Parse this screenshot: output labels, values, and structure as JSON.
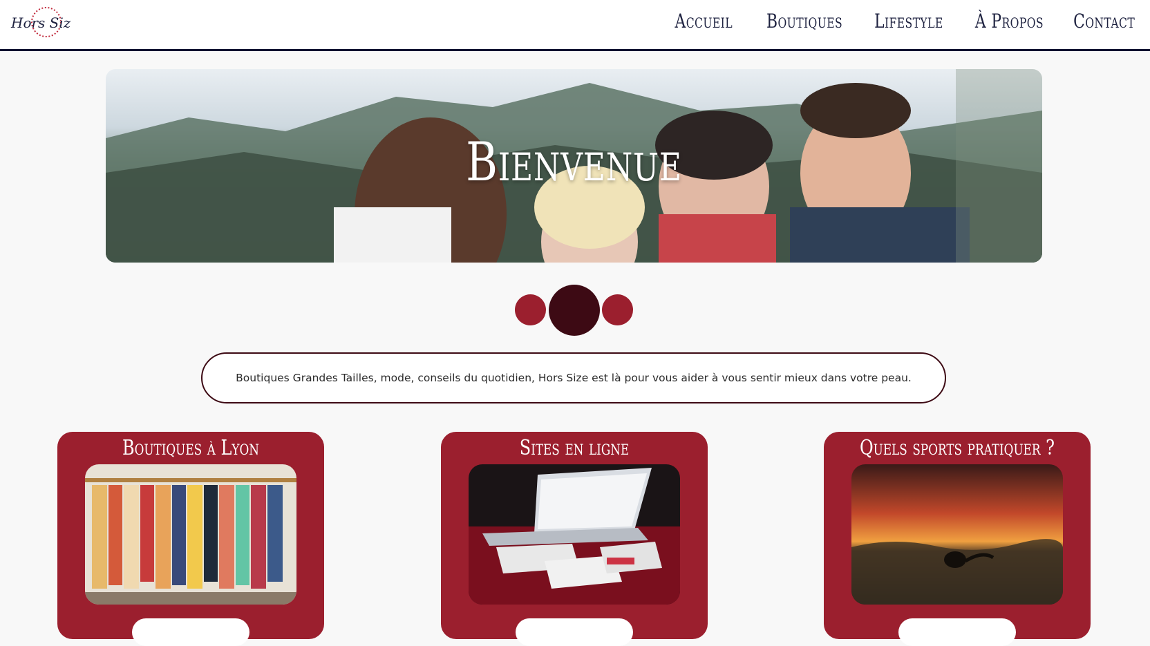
{
  "header": {
    "logo_text": "Hors Size",
    "nav": [
      "Accueil",
      "Boutiques",
      "Lifestyle",
      "À Propos",
      "Contact"
    ]
  },
  "hero": {
    "title": "Bienvenue"
  },
  "carousel": {
    "active_index": 1,
    "count": 3
  },
  "intro": {
    "text": "Boutiques Grandes Tailles, mode, conseils du quotidien, Hors Size est là pour vous aider à vous sentir mieux dans votre peau."
  },
  "cards": [
    {
      "title": "Boutiques à Lyon"
    },
    {
      "title": "Sites en ligne"
    },
    {
      "title": "Quels sports pratiquer ?"
    }
  ],
  "colors": {
    "brand": "#9b1f2e",
    "dark": "#3d0a14",
    "navy": "#0f1230"
  }
}
